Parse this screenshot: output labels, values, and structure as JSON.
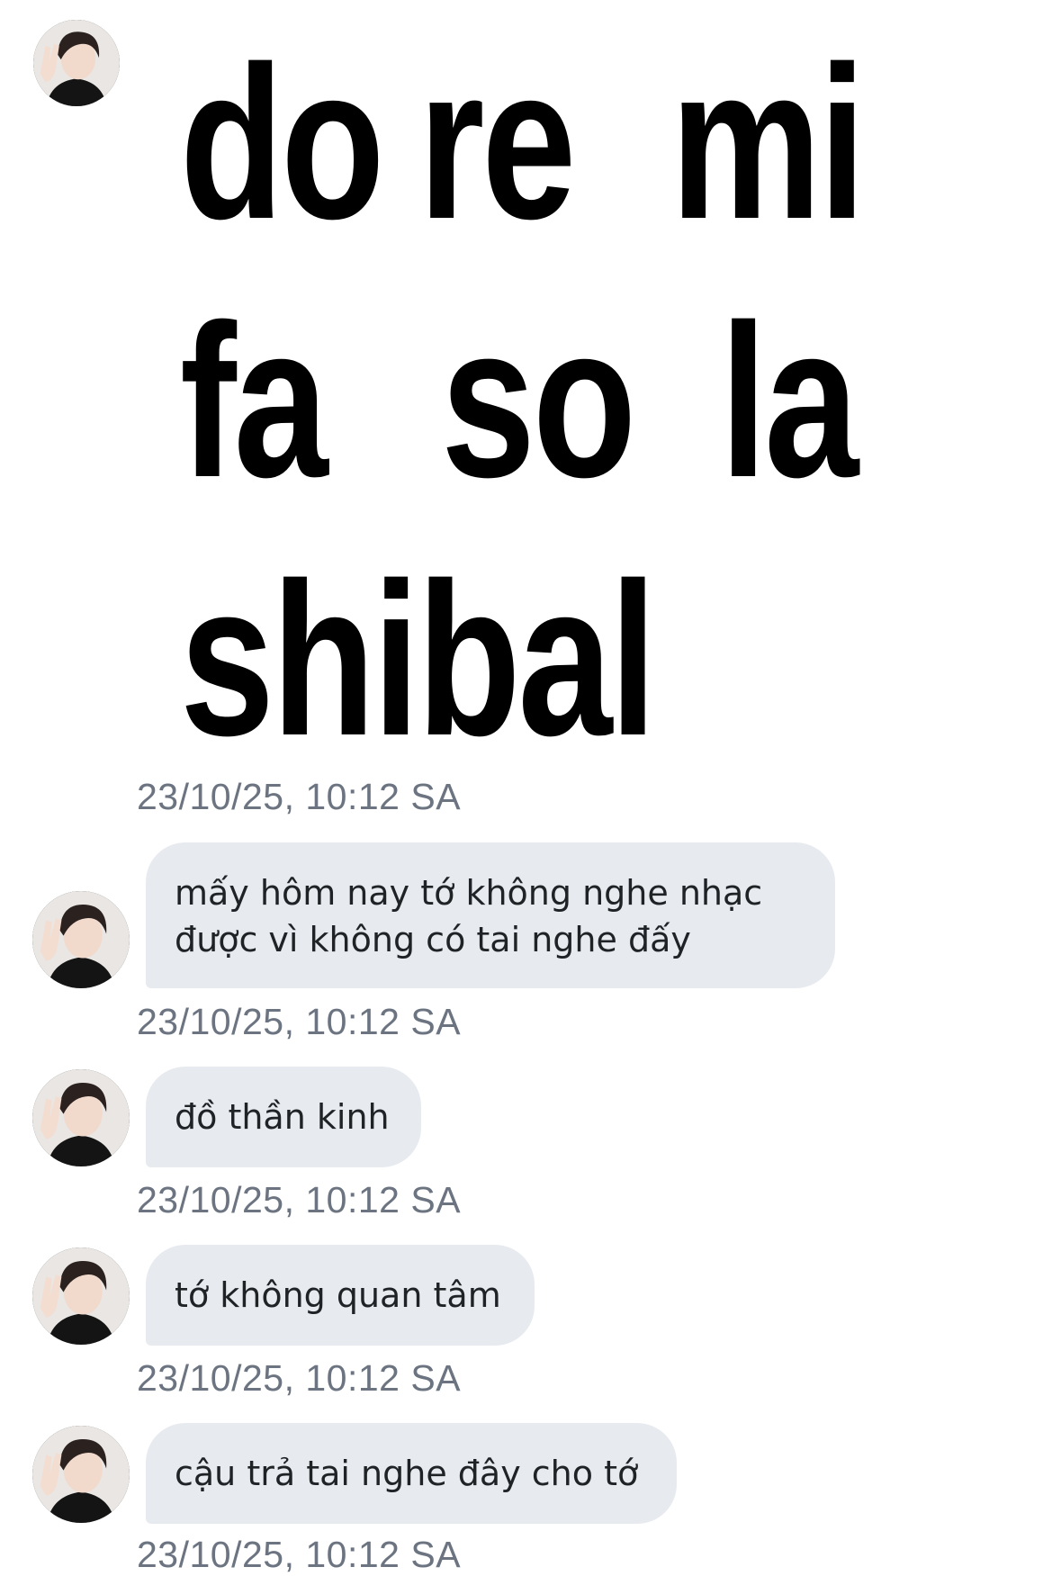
{
  "chat": {
    "sender": {
      "avatar_icon": "profile-photo-avatar"
    },
    "image_message": {
      "lines": [
        [
          "do",
          "re",
          "mi"
        ],
        [
          "fa",
          "so",
          "la"
        ],
        [
          "shibal"
        ]
      ],
      "timestamp": "23/10/25, 10:12 SA"
    },
    "messages": [
      {
        "text": "mấy hôm nay tớ không nghe nhạc\nđược vì không có tai nghe đấy",
        "timestamp": "23/10/25, 10:12 SA"
      },
      {
        "text": "đồ thần kinh",
        "timestamp": "23/10/25, 10:12 SA"
      },
      {
        "text": "tớ không quan tâm",
        "timestamp": "23/10/25, 10:12 SA"
      },
      {
        "text": "cậu trả tai nghe đây cho tớ",
        "timestamp": "23/10/25, 10:12 SA"
      }
    ]
  },
  "colors": {
    "background": "#ffffff",
    "bubble": "#e7eaef",
    "bubble_text": "#1f2326",
    "timestamp_text": "#6b7480"
  }
}
